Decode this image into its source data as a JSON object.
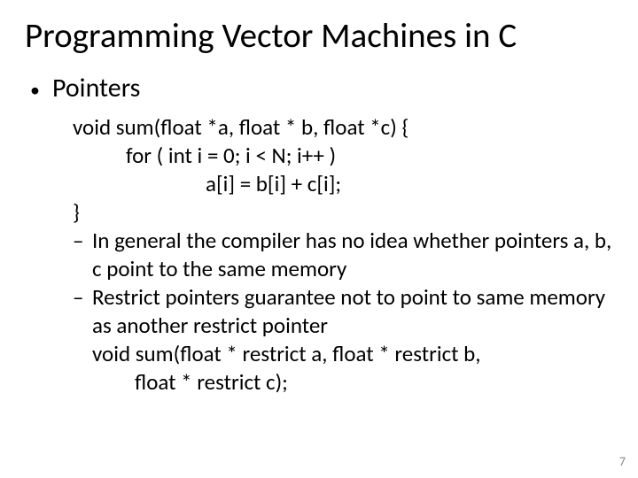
{
  "title": "Programming Vector Machines in C",
  "bullet": "Pointers",
  "code": {
    "l1": "void sum(float *a, float * b, float *c) {",
    "l2": "for ( int i = 0; i < N; i++ )",
    "l3": "a[i] = b[i] + c[i];",
    "l4": "}"
  },
  "sub": {
    "s1": "In general the compiler has no idea whether pointers a, b, c point to the same memory",
    "s2": "Restrict pointers guarantee not to point to same memory as another restrict pointer"
  },
  "restrict_sig": {
    "r1": "void sum(float * restrict a, float * restrict b,",
    "r2": "float * restrict c);"
  },
  "page_number": "7"
}
